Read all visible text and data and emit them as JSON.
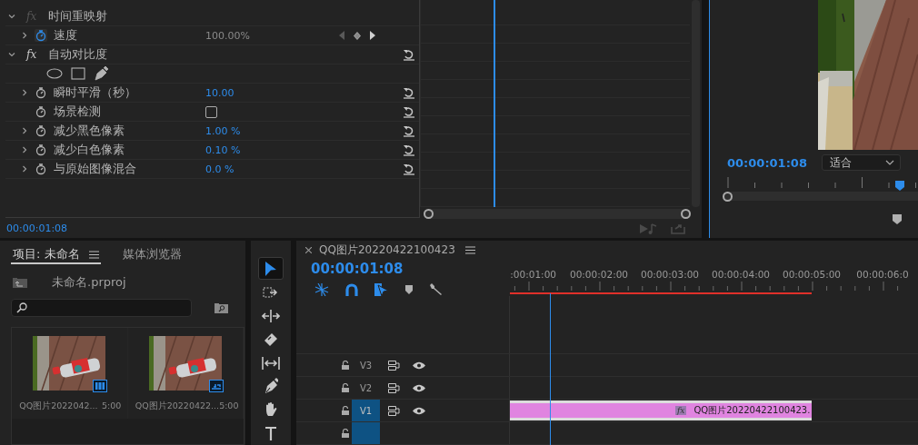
{
  "effect_controls": {
    "rows": [
      {
        "kind": "group",
        "label": "时间重映射",
        "badge": "fx",
        "expanded": true,
        "fx_on": false
      },
      {
        "kind": "param",
        "label": "速度",
        "value": "100.00%",
        "expanded": false,
        "animated": true
      },
      {
        "kind": "group",
        "label": "自动对比度",
        "badge": "fx",
        "expanded": true,
        "fx_on": true
      },
      {
        "kind": "masks"
      },
      {
        "kind": "param",
        "label": "瞬时平滑（秒）",
        "value": "10.00",
        "expanded": false,
        "animated": false
      },
      {
        "kind": "checkbox",
        "label": "场景检测",
        "checked": false,
        "animated": false
      },
      {
        "kind": "param",
        "label": "减少黑色像素",
        "value": "1.00 %",
        "expanded": false,
        "animated": false
      },
      {
        "kind": "param",
        "label": "减少白色像素",
        "value": "0.10 %",
        "expanded": false,
        "animated": false
      },
      {
        "kind": "param",
        "label": "与原始图像混合",
        "value": "0.0 %",
        "expanded": false,
        "animated": false
      }
    ],
    "timecode": "00:00:01:08"
  },
  "program_monitor": {
    "timecode": "00:00:01:08",
    "zoom": "适合"
  },
  "project": {
    "tabs": [
      {
        "label": "项目: 未命名",
        "selected": true
      },
      {
        "label": "媒体浏览器",
        "selected": false
      }
    ],
    "file": "未命名.prproj",
    "items": [
      {
        "name": "QQ图片2022042...",
        "duration": "5:00",
        "kind": "clip"
      },
      {
        "name": "QQ图片20220422...",
        "duration": "5:00",
        "kind": "sequence"
      }
    ]
  },
  "tools": [
    {
      "kind": "select",
      "selected": true
    },
    {
      "kind": "track-select",
      "selected": false
    },
    {
      "kind": "ripple",
      "selected": false
    },
    {
      "kind": "razor",
      "selected": false
    },
    {
      "kind": "slip",
      "selected": false
    },
    {
      "kind": "pen",
      "selected": false
    },
    {
      "kind": "hand",
      "selected": false
    },
    {
      "kind": "type",
      "selected": false
    }
  ],
  "timeline": {
    "title": "QQ图片20220422100423",
    "timecode": "00:00:01:08",
    "ruler_labels": [
      ":00:01:00",
      "00:00:02:00",
      "00:00:03:00",
      "00:00:04:00",
      "00:00:05:00",
      "00:00:06:0"
    ],
    "tracks": [
      {
        "label": "V3",
        "targeted": false
      },
      {
        "label": "V2",
        "targeted": false
      },
      {
        "label": "V1",
        "targeted": true,
        "clip": "QQ图片20220422100423.",
        "clip_badge": "fx"
      },
      {
        "targeted": true
      }
    ]
  }
}
